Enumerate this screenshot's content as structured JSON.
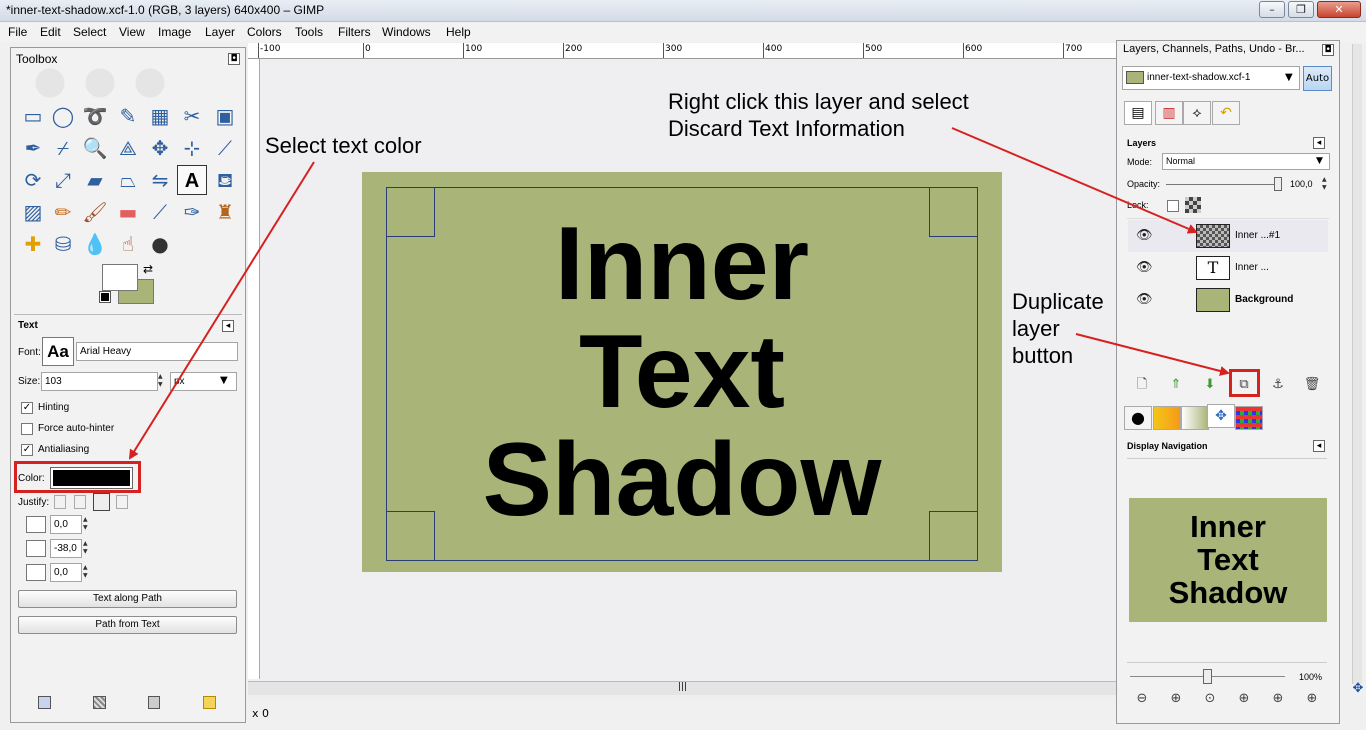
{
  "window": {
    "title": "*inner-text-shadow.xcf-1.0 (RGB, 3 layers) 640x400 – GIMP",
    "minimize": "–",
    "maximize": "❐",
    "close": "✕"
  },
  "menu": [
    "File",
    "Edit",
    "Select",
    "View",
    "Image",
    "Layer",
    "Colors",
    "Tools",
    "Filters",
    "Windows",
    "Help"
  ],
  "ruler": {
    "labels": [
      "-100",
      "0",
      "100",
      "200",
      "300",
      "400",
      "500",
      "600",
      "700"
    ]
  },
  "canvas": {
    "text_lines": [
      "Inner",
      "Text",
      "Shadow"
    ],
    "status": "x 0",
    "scroll_grip": "|||"
  },
  "toolbox": {
    "title": "Toolbox",
    "close": "◘",
    "fgbg_swap": "⇄"
  },
  "text_options": {
    "section_title": "Text",
    "section_toggle": "◂",
    "font_label": "Font:",
    "font_preview": "Aa",
    "font_value": "Arial Heavy",
    "size_label": "Size:",
    "size_value": "103",
    "unit_value": "px",
    "dropdown_arrow": "▼",
    "hinting_label": "Hinting",
    "hinting_checked": true,
    "check_mark": "✓",
    "autohinter_label": "Force auto-hinter",
    "autohinter_checked": false,
    "antialiasing_label": "Antialiasing",
    "antialiasing_checked": true,
    "color_label": "Color:",
    "color_value": "#000000",
    "justify_label": "Justify:",
    "indent_value": "0,0",
    "line_spacing_value": "-38,0",
    "letter_spacing_value": "0,0",
    "text_along_path_button": "Text along Path",
    "path_from_text_button": "Path from Text"
  },
  "dock": {
    "title": "Layers, Channels, Paths, Undo - Br...",
    "close": "◘",
    "image_select": "inner-text-shadow.xcf-1",
    "auto_button": "Auto",
    "panel_toggle": "◂",
    "layers_title": "Layers",
    "mode_label": "Mode:",
    "mode_value": "Normal",
    "opacity_label": "Opacity:",
    "opacity_value": "100,0",
    "lock_label": "Lock:",
    "layers": [
      {
        "name": "Inner ...#1",
        "selected": true
      },
      {
        "name": "Inner ...",
        "selected": false
      },
      {
        "name": "Background",
        "selected": false
      }
    ],
    "eye_glyph": "👁",
    "nav_title": "Display Navigation",
    "zoom_value": "100%",
    "preview_lines": [
      "Inner",
      "Text",
      "Shadow"
    ]
  },
  "annotations": {
    "select_color": "Select text color",
    "discard_line1": "Right click this layer and select",
    "discard_line2": "Discard Text Information",
    "duplicate_line1": "Duplicate",
    "duplicate_line2": "layer",
    "duplicate_line3": "button"
  },
  "colors": {
    "image_bg": "#a9b479",
    "annotation_red": "#d62121",
    "frame_blue": "#2b3c7a"
  }
}
